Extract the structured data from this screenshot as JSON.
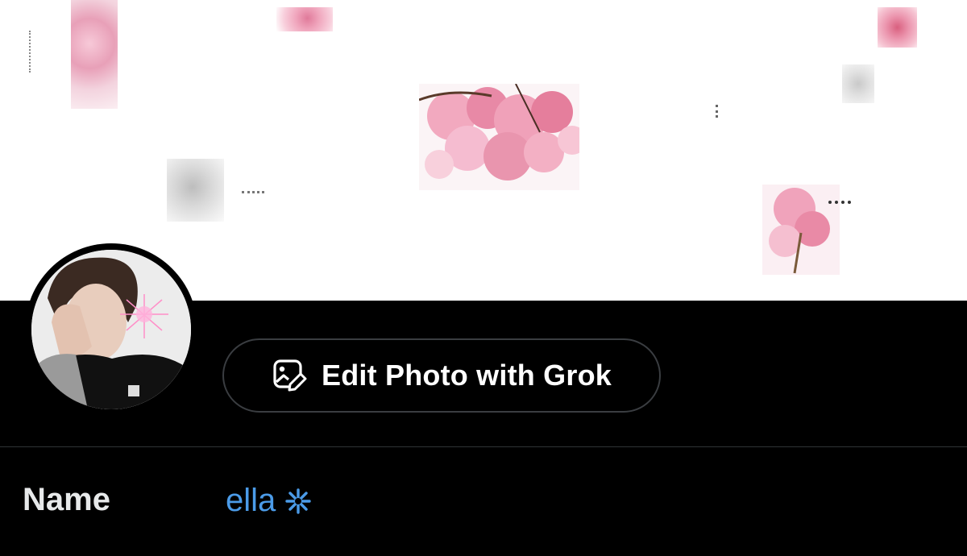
{
  "profile_edit": {
    "edit_photo_button": {
      "label": "Edit Photo with Grok",
      "icon": "image-edit-icon"
    },
    "name_field": {
      "label": "Name",
      "value": "ella",
      "decoration_icon": "asterisk-icon"
    }
  },
  "colors": {
    "background": "#000000",
    "banner_background": "#ffffff",
    "button_border": "#3a3d41",
    "name_value": "#4b9be8",
    "divider": "#2f3336"
  }
}
